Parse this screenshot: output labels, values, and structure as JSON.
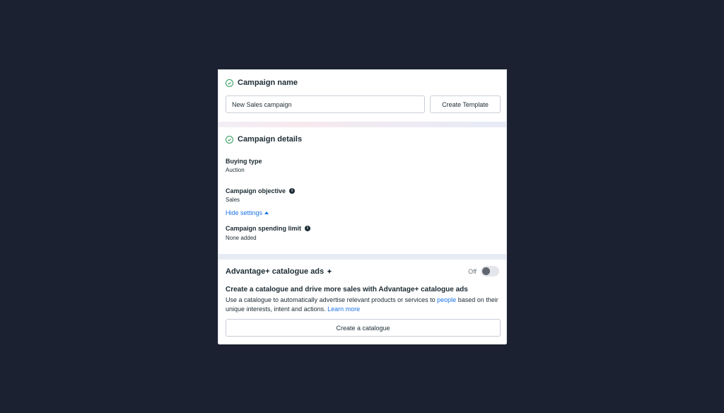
{
  "campaign_name": {
    "title": "Campaign name",
    "input_value": "New Sales campaign",
    "create_template_label": "Create Template"
  },
  "campaign_details": {
    "title": "Campaign details",
    "buying_type_label": "Buying type",
    "buying_type_value": "Auction",
    "objective_label": "Campaign objective",
    "objective_value": "Sales",
    "hide_settings_label": "Hide settings",
    "spending_limit_label": "Campaign spending limit",
    "spending_limit_value": "None added"
  },
  "advantage": {
    "title": "Advantage+ catalogue ads",
    "toggle_label": "Off",
    "toggle_on": false,
    "headline": "Create a catalogue and drive more sales with Advantage+ catalogue ads",
    "desc_part1": "Use a catalogue to automatically advertise relevant products or services to ",
    "desc_link_people": "people",
    "desc_part2": " based on their unique interests, intent and actions. ",
    "desc_link_learn": "Learn more",
    "create_catalogue_label": "Create a catalogue"
  },
  "icons": {
    "check": "check-circle-icon",
    "info": "info-icon",
    "caret": "caret-up-icon",
    "sparkle": "sparkle-icon"
  },
  "colors": {
    "background": "#1b2130",
    "check_green": "#2f9e5d",
    "link_blue": "#1b74e4",
    "text": "#1c2b33"
  }
}
